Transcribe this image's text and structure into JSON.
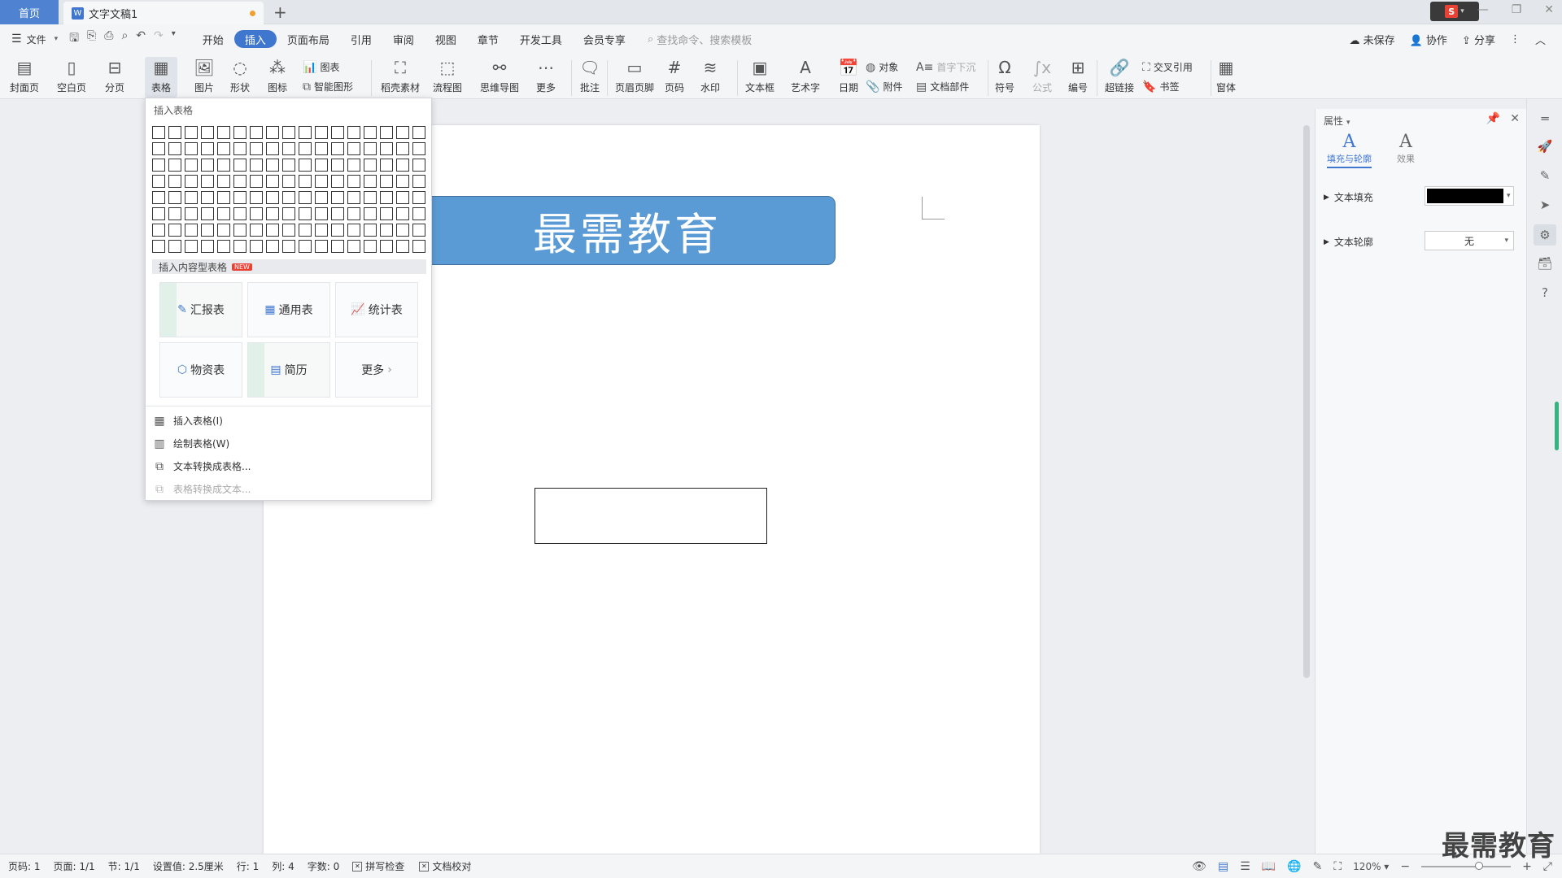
{
  "titlebar": {
    "home_tab": "首页",
    "doc_icon": "W",
    "doc_tab": "文字文稿1",
    "new_tab": "+",
    "avatar_letter": "S"
  },
  "menu": {
    "file": "文件",
    "tabs": [
      "开始",
      "插入",
      "页面布局",
      "引用",
      "审阅",
      "视图",
      "章节",
      "开发工具",
      "会员专享"
    ],
    "active_tab": "插入",
    "search_placeholder": "查找命令、搜索模板",
    "unsaved": "未保存",
    "collaborate": "协作",
    "share": "分享"
  },
  "ribbon": {
    "cover": "封面页",
    "blank": "空白页",
    "pagebreak": "分页",
    "table": "表格",
    "picture": "图片",
    "shape": "形状",
    "icon": "图标",
    "chart": "图表",
    "smartart": "智能图形",
    "material": "稻壳素材",
    "flowchart": "流程图",
    "mindmap": "思维导图",
    "more": "更多",
    "comment": "批注",
    "header_footer": "页眉页脚",
    "page_num": "页码",
    "watermark": "水印",
    "textbox": "文本框",
    "wordart": "艺术字",
    "date": "日期",
    "object": "对象",
    "attachment": "附件",
    "dropcap": "首字下沉",
    "doc_parts": "文档部件",
    "symbol": "符号",
    "formula": "公式",
    "numbering": "编号",
    "hyperlink": "超链接",
    "crossref": "交叉引用",
    "bookmark": "书签",
    "window": "窗体"
  },
  "dropdown": {
    "title": "插入表格",
    "grid_cols": 17,
    "grid_rows": 8,
    "section": "插入内容型表格",
    "new_badge": "NEW",
    "templates": [
      "汇报表",
      "通用表",
      "统计表",
      "物资表",
      "简历",
      "更多"
    ],
    "items": [
      "插入表格(I)",
      "绘制表格(W)",
      "文本转换成表格...",
      "表格转换成文本..."
    ]
  },
  "document": {
    "banner_text": "最需教育"
  },
  "props": {
    "header": "属性",
    "tab_fill": "填充与轮廓",
    "tab_effect": "效果",
    "text_fill": "文本填充",
    "text_outline": "文本轮廓",
    "outline_value": "无",
    "fill_color": "#000000"
  },
  "status": {
    "page_num": "页码: 1",
    "pages": "页面: 1/1",
    "section": "节: 1/1",
    "setting": "设置值: 2.5厘米",
    "row": "行: 1",
    "col": "列: 4",
    "words": "字数: 0",
    "spell": "拼写检查",
    "proof": "文档校对",
    "zoom": "120%"
  },
  "watermark_text": "最需教育",
  "colors": {
    "accent": "#3f77cf",
    "banner": "#5b9bd5"
  }
}
